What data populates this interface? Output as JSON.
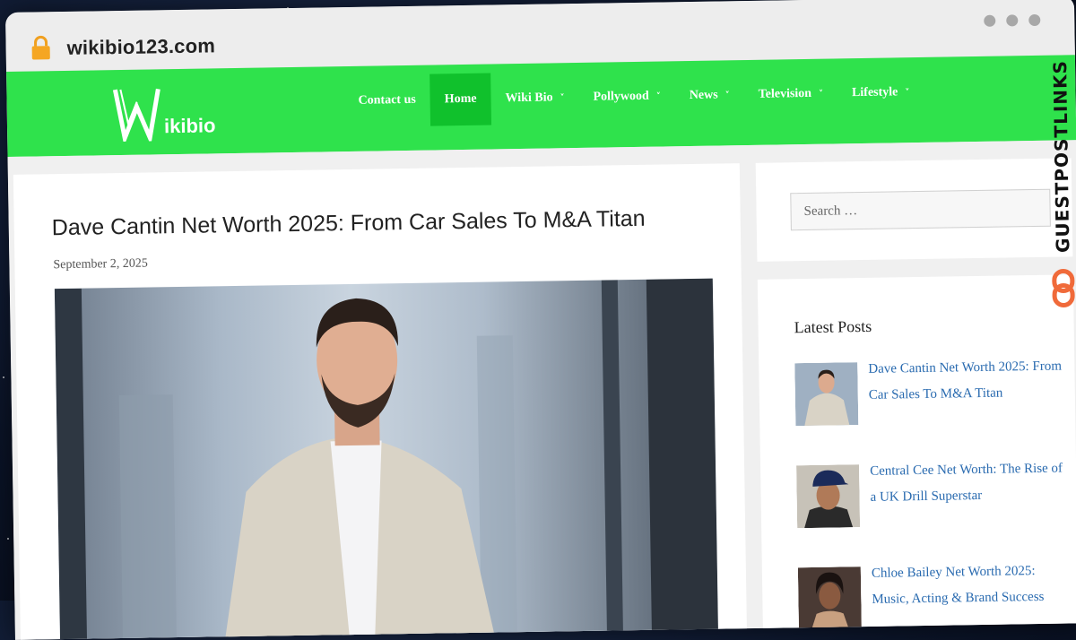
{
  "browser": {
    "url": "wikibio123.com"
  },
  "site": {
    "logo_text": "ikibio",
    "nav": [
      {
        "label": "Contact us",
        "dropdown": false,
        "active": false
      },
      {
        "label": "Home",
        "dropdown": false,
        "active": true
      },
      {
        "label": "Wiki Bio",
        "dropdown": true,
        "active": false
      },
      {
        "label": "Pollywood",
        "dropdown": true,
        "active": false
      },
      {
        "label": "News",
        "dropdown": true,
        "active": false
      },
      {
        "label": "Television",
        "dropdown": true,
        "active": false
      },
      {
        "label": "Lifestyle",
        "dropdown": true,
        "active": false
      }
    ],
    "colors": {
      "nav_bg": "#2fe24c",
      "active_bg": "#10c12c",
      "link": "#2a6bb0"
    }
  },
  "article": {
    "title": "Dave Cantin Net Worth 2025: From Car Sales To M&A Titan",
    "date": "September 2, 2025"
  },
  "sidebar": {
    "search_placeholder": "Search …",
    "latest_title": "Latest Posts",
    "posts": [
      {
        "title": "Dave Cantin Net Worth 2025: From Car Sales To M&A Titan"
      },
      {
        "title": "Central Cee Net Worth: The Rise of a UK Drill Superstar"
      },
      {
        "title": "Chloe Bailey Net Worth 2025: Music, Acting & Brand Success"
      }
    ]
  },
  "watermark": {
    "text": "GUESTPOSTLINKS",
    "icon": "link-icon"
  }
}
